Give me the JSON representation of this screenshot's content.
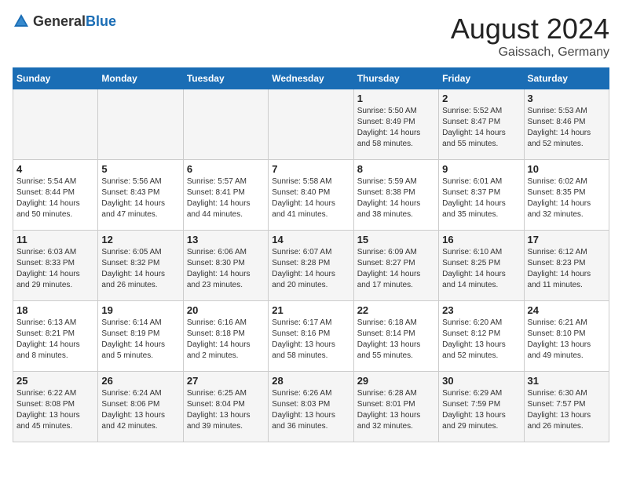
{
  "header": {
    "logo_general": "General",
    "logo_blue": "Blue",
    "month_year": "August 2024",
    "location": "Gaissach, Germany"
  },
  "weekdays": [
    "Sunday",
    "Monday",
    "Tuesday",
    "Wednesday",
    "Thursday",
    "Friday",
    "Saturday"
  ],
  "weeks": [
    [
      {
        "day": "",
        "info": ""
      },
      {
        "day": "",
        "info": ""
      },
      {
        "day": "",
        "info": ""
      },
      {
        "day": "",
        "info": ""
      },
      {
        "day": "1",
        "info": "Sunrise: 5:50 AM\nSunset: 8:49 PM\nDaylight: 14 hours\nand 58 minutes."
      },
      {
        "day": "2",
        "info": "Sunrise: 5:52 AM\nSunset: 8:47 PM\nDaylight: 14 hours\nand 55 minutes."
      },
      {
        "day": "3",
        "info": "Sunrise: 5:53 AM\nSunset: 8:46 PM\nDaylight: 14 hours\nand 52 minutes."
      }
    ],
    [
      {
        "day": "4",
        "info": "Sunrise: 5:54 AM\nSunset: 8:44 PM\nDaylight: 14 hours\nand 50 minutes."
      },
      {
        "day": "5",
        "info": "Sunrise: 5:56 AM\nSunset: 8:43 PM\nDaylight: 14 hours\nand 47 minutes."
      },
      {
        "day": "6",
        "info": "Sunrise: 5:57 AM\nSunset: 8:41 PM\nDaylight: 14 hours\nand 44 minutes."
      },
      {
        "day": "7",
        "info": "Sunrise: 5:58 AM\nSunset: 8:40 PM\nDaylight: 14 hours\nand 41 minutes."
      },
      {
        "day": "8",
        "info": "Sunrise: 5:59 AM\nSunset: 8:38 PM\nDaylight: 14 hours\nand 38 minutes."
      },
      {
        "day": "9",
        "info": "Sunrise: 6:01 AM\nSunset: 8:37 PM\nDaylight: 14 hours\nand 35 minutes."
      },
      {
        "day": "10",
        "info": "Sunrise: 6:02 AM\nSunset: 8:35 PM\nDaylight: 14 hours\nand 32 minutes."
      }
    ],
    [
      {
        "day": "11",
        "info": "Sunrise: 6:03 AM\nSunset: 8:33 PM\nDaylight: 14 hours\nand 29 minutes."
      },
      {
        "day": "12",
        "info": "Sunrise: 6:05 AM\nSunset: 8:32 PM\nDaylight: 14 hours\nand 26 minutes."
      },
      {
        "day": "13",
        "info": "Sunrise: 6:06 AM\nSunset: 8:30 PM\nDaylight: 14 hours\nand 23 minutes."
      },
      {
        "day": "14",
        "info": "Sunrise: 6:07 AM\nSunset: 8:28 PM\nDaylight: 14 hours\nand 20 minutes."
      },
      {
        "day": "15",
        "info": "Sunrise: 6:09 AM\nSunset: 8:27 PM\nDaylight: 14 hours\nand 17 minutes."
      },
      {
        "day": "16",
        "info": "Sunrise: 6:10 AM\nSunset: 8:25 PM\nDaylight: 14 hours\nand 14 minutes."
      },
      {
        "day": "17",
        "info": "Sunrise: 6:12 AM\nSunset: 8:23 PM\nDaylight: 14 hours\nand 11 minutes."
      }
    ],
    [
      {
        "day": "18",
        "info": "Sunrise: 6:13 AM\nSunset: 8:21 PM\nDaylight: 14 hours\nand 8 minutes."
      },
      {
        "day": "19",
        "info": "Sunrise: 6:14 AM\nSunset: 8:19 PM\nDaylight: 14 hours\nand 5 minutes."
      },
      {
        "day": "20",
        "info": "Sunrise: 6:16 AM\nSunset: 8:18 PM\nDaylight: 14 hours\nand 2 minutes."
      },
      {
        "day": "21",
        "info": "Sunrise: 6:17 AM\nSunset: 8:16 PM\nDaylight: 13 hours\nand 58 minutes."
      },
      {
        "day": "22",
        "info": "Sunrise: 6:18 AM\nSunset: 8:14 PM\nDaylight: 13 hours\nand 55 minutes."
      },
      {
        "day": "23",
        "info": "Sunrise: 6:20 AM\nSunset: 8:12 PM\nDaylight: 13 hours\nand 52 minutes."
      },
      {
        "day": "24",
        "info": "Sunrise: 6:21 AM\nSunset: 8:10 PM\nDaylight: 13 hours\nand 49 minutes."
      }
    ],
    [
      {
        "day": "25",
        "info": "Sunrise: 6:22 AM\nSunset: 8:08 PM\nDaylight: 13 hours\nand 45 minutes."
      },
      {
        "day": "26",
        "info": "Sunrise: 6:24 AM\nSunset: 8:06 PM\nDaylight: 13 hours\nand 42 minutes."
      },
      {
        "day": "27",
        "info": "Sunrise: 6:25 AM\nSunset: 8:04 PM\nDaylight: 13 hours\nand 39 minutes."
      },
      {
        "day": "28",
        "info": "Sunrise: 6:26 AM\nSunset: 8:03 PM\nDaylight: 13 hours\nand 36 minutes."
      },
      {
        "day": "29",
        "info": "Sunrise: 6:28 AM\nSunset: 8:01 PM\nDaylight: 13 hours\nand 32 minutes."
      },
      {
        "day": "30",
        "info": "Sunrise: 6:29 AM\nSunset: 7:59 PM\nDaylight: 13 hours\nand 29 minutes."
      },
      {
        "day": "31",
        "info": "Sunrise: 6:30 AM\nSunset: 7:57 PM\nDaylight: 13 hours\nand 26 minutes."
      }
    ]
  ]
}
